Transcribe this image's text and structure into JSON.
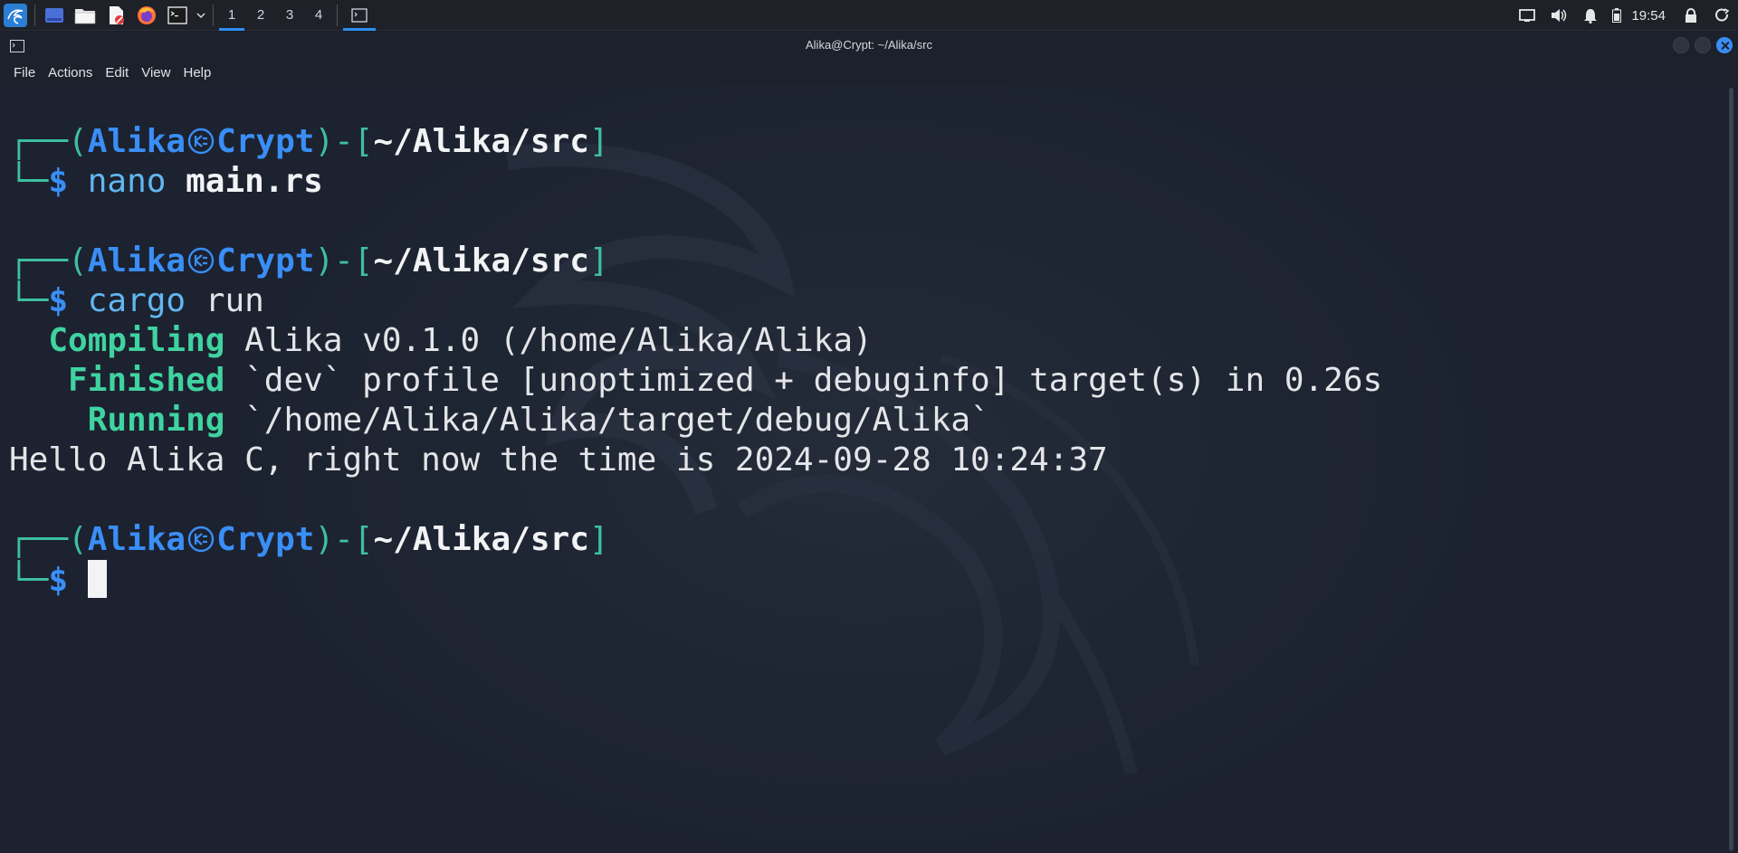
{
  "panel": {
    "workspaces": [
      "1",
      "2",
      "3",
      "4"
    ],
    "active_workspace": "1",
    "clock": "19:54",
    "apps": [
      "show-desktop-icon",
      "file-manager-icon",
      "text-editor-icon",
      "firefox-icon",
      "terminal-icon"
    ]
  },
  "window": {
    "title": "Alika@Crypt: ~/Alika/src",
    "menu": [
      "File",
      "Actions",
      "Edit",
      "View",
      "Help"
    ]
  },
  "terminal": {
    "prompt": {
      "user": "Alika",
      "host": "Crypt",
      "path": "~/Alika/src",
      "dollar": "$"
    },
    "commands": [
      {
        "cmd": "nano",
        "arg": "main.rs"
      },
      {
        "cmd": "cargo",
        "arg": "run"
      }
    ],
    "output": {
      "compiling_label": "Compiling",
      "compiling_text": "Alika v0.1.0 (/home/Alika/Alika)",
      "finished_label": "Finished",
      "finished_text": "`dev` profile [unoptimized + debuginfo] target(s) in 0.26s",
      "running_label": "Running",
      "running_text": "`/home/Alika/Alika/target/debug/Alika`",
      "hello": "Hello Alika C, right now the time is 2024-09-28 10:24:37"
    }
  },
  "colors": {
    "accent": "#3a8ef6",
    "prompt_frame": "#3fbfa0",
    "cargo_status": "#3fd3a0",
    "background": "#1e2431"
  }
}
